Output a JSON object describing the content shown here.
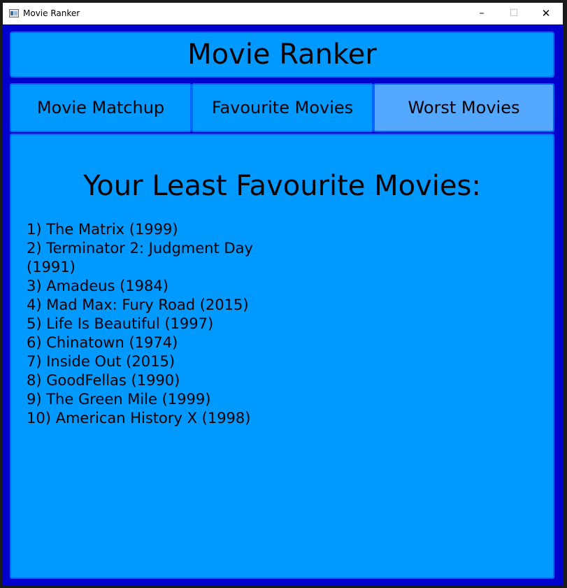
{
  "window": {
    "title": "Movie Ranker",
    "controls": {
      "minimize": "–",
      "maximize": "☐",
      "close": "✕"
    }
  },
  "header": {
    "title": "Movie Ranker"
  },
  "tabs": [
    {
      "label": "Movie Matchup",
      "active": false
    },
    {
      "label": "Favourite Movies",
      "active": false
    },
    {
      "label": "Worst Movies",
      "active": true
    }
  ],
  "main": {
    "heading": "Your Least Favourite Movies:",
    "movies": [
      "1) The Matrix (1999)",
      "2) Terminator 2: Judgment Day (1991)",
      "3) Amadeus (1984)",
      "4) Mad Max: Fury Road (2015)",
      "5) Life Is Beautiful (1997)",
      "6) Chinatown (1974)",
      "7) Inside Out (2015)",
      "8) GoodFellas (1990)",
      "9) The Green Mile (1999)",
      "10) American History X (1998)"
    ]
  },
  "colors": {
    "window_background": "#0000cc",
    "panel_background": "#0099ff",
    "panel_border": "#0066ff",
    "active_tab_background": "#55a8ff"
  }
}
